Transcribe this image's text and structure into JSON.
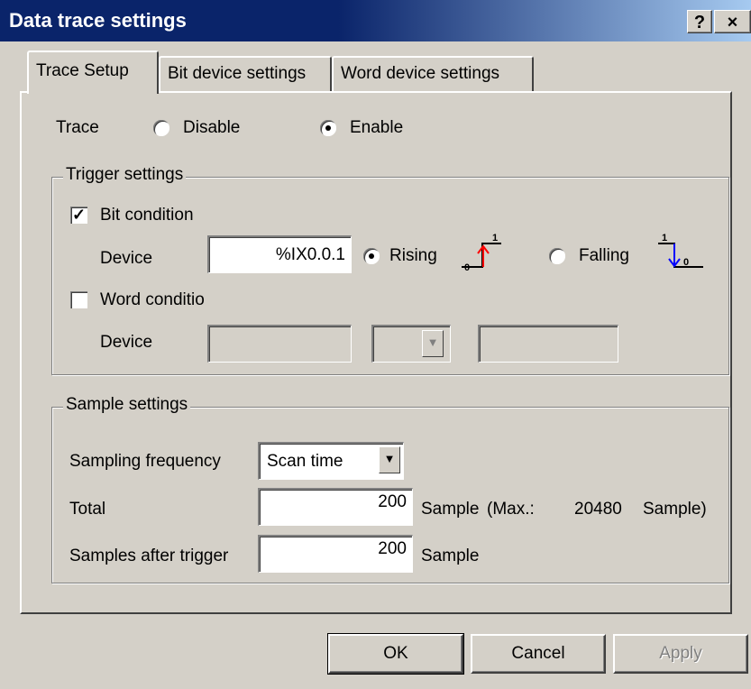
{
  "window": {
    "title": "Data trace settings",
    "help_label": "?",
    "close_label": "×"
  },
  "tabs": [
    {
      "label": "Trace Setup",
      "active": true
    },
    {
      "label": "Bit device settings",
      "active": false
    },
    {
      "label": "Word device settings",
      "active": false
    }
  ],
  "trace": {
    "label": "Trace",
    "disable_label": "Disable",
    "enable_label": "Enable",
    "selected": "Enable"
  },
  "trigger": {
    "group_label": "Trigger settings",
    "bit_condition_label": "Bit condition",
    "bit_condition_checked": true,
    "bit_device_label": "Device",
    "bit_device_value": "%IX0.0.1",
    "rising_label": "Rising",
    "falling_label": "Falling",
    "edge_selected": "Rising",
    "rising_icon_low": "0",
    "rising_icon_high": "1",
    "falling_icon_low": "0",
    "falling_icon_high": "1",
    "word_condition_label": "Word conditio",
    "word_condition_checked": false,
    "word_device_label": "Device",
    "word_device_value": "",
    "word_operator_value": "",
    "word_compare_value": ""
  },
  "sample": {
    "group_label": "Sample settings",
    "frequency_label": "Sampling frequency",
    "frequency_value": "Scan time",
    "total_label": "Total",
    "total_value": "200",
    "total_unit": "Sample",
    "max_label": "(Max.:",
    "max_value": "20480",
    "max_unit": "Sample)",
    "after_label": "Samples after trigger",
    "after_value": "200",
    "after_unit": "Sample"
  },
  "buttons": {
    "ok": "OK",
    "cancel": "Cancel",
    "apply": "Apply"
  },
  "icons": {
    "check_mark": "✓",
    "dropdown": "▼"
  },
  "colors": {
    "rising_edge": "#ff0000",
    "falling_edge": "#0000ff",
    "title_bar": "#0a246a"
  }
}
